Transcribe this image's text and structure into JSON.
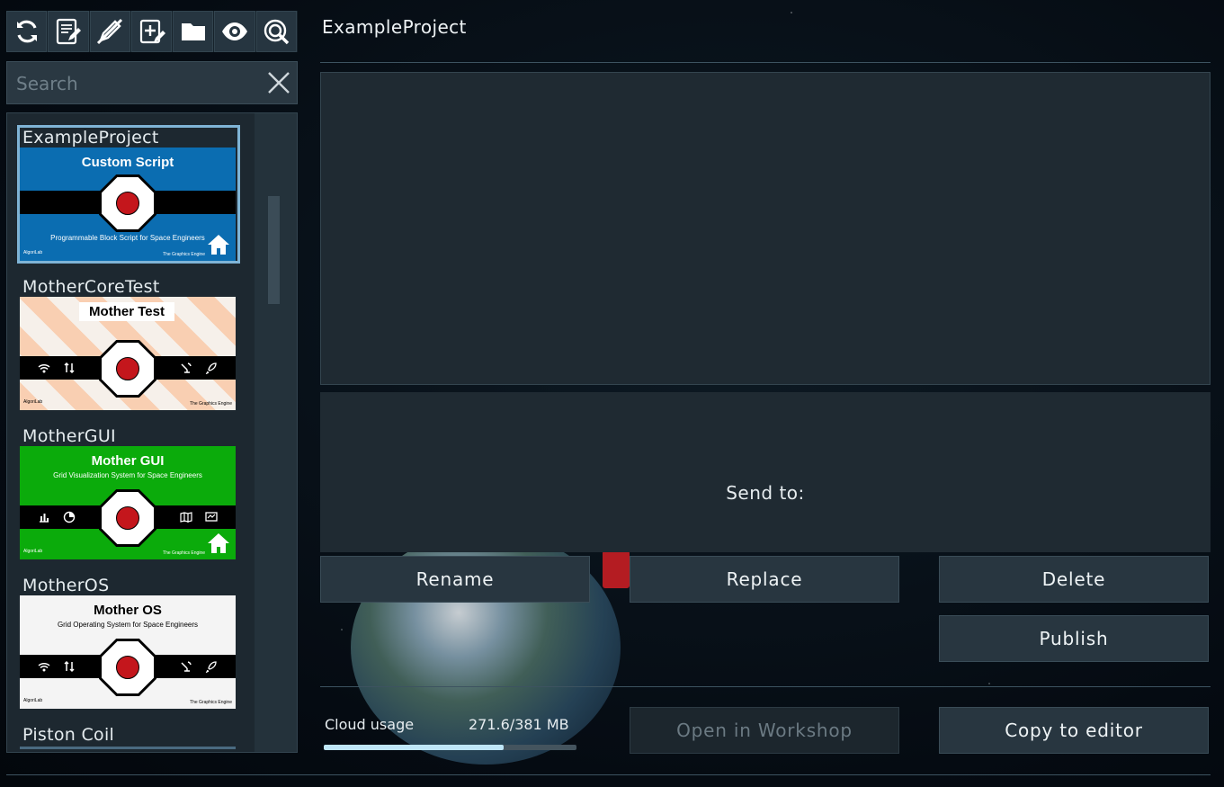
{
  "toolbar": {
    "buttons": [
      {
        "icon": "refresh-icon"
      },
      {
        "icon": "edit-script-icon"
      },
      {
        "icon": "no-edit-icon"
      },
      {
        "icon": "new-script-icon"
      },
      {
        "icon": "folder-icon"
      },
      {
        "icon": "eye-icon"
      },
      {
        "icon": "workshop-search-icon"
      }
    ]
  },
  "search": {
    "placeholder": "Search"
  },
  "scripts": [
    {
      "title": "ExampleProject",
      "thumb_name": "Custom Script",
      "thumb_sub": "Programmable Block Script for Space Engineers",
      "bg": "#0b6db1",
      "text_color": "#ffffff",
      "footer_left": "AlgoriLab",
      "footer_right": "The Graphics Engine",
      "selected": true
    },
    {
      "title": "MotherCoreTest",
      "thumb_name": "Mother Test",
      "thumb_sub": "",
      "bg": "#f9cfb2",
      "text_color": "#000000",
      "footer_left": "AlgoriLab",
      "footer_right": "The Graphics Engine",
      "selected": false
    },
    {
      "title": "MotherGUI",
      "thumb_name": "Mother GUI",
      "thumb_sub": "Grid Visualization System for Space Engineers",
      "bg": "#0bab0b",
      "text_color": "#ffffff",
      "footer_left": "AlgoriLab",
      "footer_right": "The Graphics Engine",
      "selected": false
    },
    {
      "title": "MotherOS",
      "thumb_name": "Mother OS",
      "thumb_sub": "Grid Operating System for Space Engineers",
      "bg": "#f4f4f4",
      "text_color": "#000000",
      "footer_left": "AlgoriLab",
      "footer_right": "The Graphics Engine",
      "selected": false
    },
    {
      "title": "Piston Coil"
    }
  ],
  "detail": {
    "title": "ExampleProject",
    "send_to_label": "Send to:"
  },
  "actions": {
    "rename": "Rename",
    "replace": "Replace",
    "delete": "Delete",
    "publish": "Publish",
    "open_workshop": "Open in Workshop",
    "copy_to_editor": "Copy to editor"
  },
  "cloud": {
    "label": "Cloud usage",
    "value": "271.6/381 MB",
    "fraction": 0.713
  },
  "colors": {
    "accent": "#7fb4d6",
    "panel": "#1f2a32",
    "button": "#283640"
  }
}
